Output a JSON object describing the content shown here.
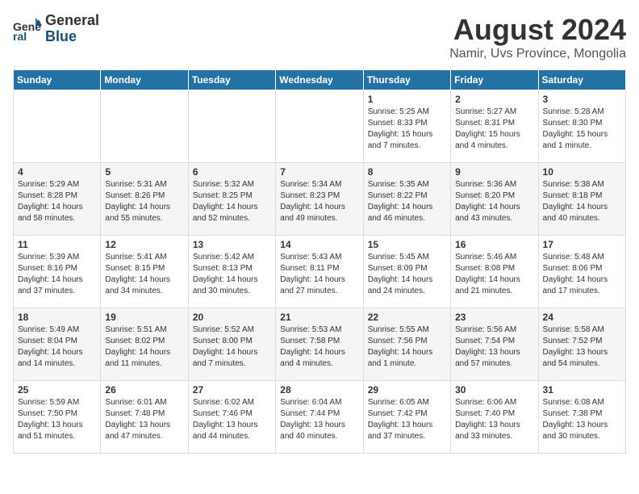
{
  "logo": {
    "general": "General",
    "blue": "Blue"
  },
  "header": {
    "month": "August 2024",
    "location": "Namir, Uvs Province, Mongolia"
  },
  "weekdays": [
    "Sunday",
    "Monday",
    "Tuesday",
    "Wednesday",
    "Thursday",
    "Friday",
    "Saturday"
  ],
  "weeks": [
    [
      {
        "day": "",
        "info": ""
      },
      {
        "day": "",
        "info": ""
      },
      {
        "day": "",
        "info": ""
      },
      {
        "day": "",
        "info": ""
      },
      {
        "day": "1",
        "info": "Sunrise: 5:25 AM\nSunset: 8:33 PM\nDaylight: 15 hours\nand 7 minutes."
      },
      {
        "day": "2",
        "info": "Sunrise: 5:27 AM\nSunset: 8:31 PM\nDaylight: 15 hours\nand 4 minutes."
      },
      {
        "day": "3",
        "info": "Sunrise: 5:28 AM\nSunset: 8:30 PM\nDaylight: 15 hours\nand 1 minute."
      }
    ],
    [
      {
        "day": "4",
        "info": "Sunrise: 5:29 AM\nSunset: 8:28 PM\nDaylight: 14 hours\nand 58 minutes."
      },
      {
        "day": "5",
        "info": "Sunrise: 5:31 AM\nSunset: 8:26 PM\nDaylight: 14 hours\nand 55 minutes."
      },
      {
        "day": "6",
        "info": "Sunrise: 5:32 AM\nSunset: 8:25 PM\nDaylight: 14 hours\nand 52 minutes."
      },
      {
        "day": "7",
        "info": "Sunrise: 5:34 AM\nSunset: 8:23 PM\nDaylight: 14 hours\nand 49 minutes."
      },
      {
        "day": "8",
        "info": "Sunrise: 5:35 AM\nSunset: 8:22 PM\nDaylight: 14 hours\nand 46 minutes."
      },
      {
        "day": "9",
        "info": "Sunrise: 5:36 AM\nSunset: 8:20 PM\nDaylight: 14 hours\nand 43 minutes."
      },
      {
        "day": "10",
        "info": "Sunrise: 5:38 AM\nSunset: 8:18 PM\nDaylight: 14 hours\nand 40 minutes."
      }
    ],
    [
      {
        "day": "11",
        "info": "Sunrise: 5:39 AM\nSunset: 8:16 PM\nDaylight: 14 hours\nand 37 minutes."
      },
      {
        "day": "12",
        "info": "Sunrise: 5:41 AM\nSunset: 8:15 PM\nDaylight: 14 hours\nand 34 minutes."
      },
      {
        "day": "13",
        "info": "Sunrise: 5:42 AM\nSunset: 8:13 PM\nDaylight: 14 hours\nand 30 minutes."
      },
      {
        "day": "14",
        "info": "Sunrise: 5:43 AM\nSunset: 8:11 PM\nDaylight: 14 hours\nand 27 minutes."
      },
      {
        "day": "15",
        "info": "Sunrise: 5:45 AM\nSunset: 8:09 PM\nDaylight: 14 hours\nand 24 minutes."
      },
      {
        "day": "16",
        "info": "Sunrise: 5:46 AM\nSunset: 8:08 PM\nDaylight: 14 hours\nand 21 minutes."
      },
      {
        "day": "17",
        "info": "Sunrise: 5:48 AM\nSunset: 8:06 PM\nDaylight: 14 hours\nand 17 minutes."
      }
    ],
    [
      {
        "day": "18",
        "info": "Sunrise: 5:49 AM\nSunset: 8:04 PM\nDaylight: 14 hours\nand 14 minutes."
      },
      {
        "day": "19",
        "info": "Sunrise: 5:51 AM\nSunset: 8:02 PM\nDaylight: 14 hours\nand 11 minutes."
      },
      {
        "day": "20",
        "info": "Sunrise: 5:52 AM\nSunset: 8:00 PM\nDaylight: 14 hours\nand 7 minutes."
      },
      {
        "day": "21",
        "info": "Sunrise: 5:53 AM\nSunset: 7:58 PM\nDaylight: 14 hours\nand 4 minutes."
      },
      {
        "day": "22",
        "info": "Sunrise: 5:55 AM\nSunset: 7:56 PM\nDaylight: 14 hours\nand 1 minute."
      },
      {
        "day": "23",
        "info": "Sunrise: 5:56 AM\nSunset: 7:54 PM\nDaylight: 13 hours\nand 57 minutes."
      },
      {
        "day": "24",
        "info": "Sunrise: 5:58 AM\nSunset: 7:52 PM\nDaylight: 13 hours\nand 54 minutes."
      }
    ],
    [
      {
        "day": "25",
        "info": "Sunrise: 5:59 AM\nSunset: 7:50 PM\nDaylight: 13 hours\nand 51 minutes."
      },
      {
        "day": "26",
        "info": "Sunrise: 6:01 AM\nSunset: 7:48 PM\nDaylight: 13 hours\nand 47 minutes."
      },
      {
        "day": "27",
        "info": "Sunrise: 6:02 AM\nSunset: 7:46 PM\nDaylight: 13 hours\nand 44 minutes."
      },
      {
        "day": "28",
        "info": "Sunrise: 6:04 AM\nSunset: 7:44 PM\nDaylight: 13 hours\nand 40 minutes."
      },
      {
        "day": "29",
        "info": "Sunrise: 6:05 AM\nSunset: 7:42 PM\nDaylight: 13 hours\nand 37 minutes."
      },
      {
        "day": "30",
        "info": "Sunrise: 6:06 AM\nSunset: 7:40 PM\nDaylight: 13 hours\nand 33 minutes."
      },
      {
        "day": "31",
        "info": "Sunrise: 6:08 AM\nSunset: 7:38 PM\nDaylight: 13 hours\nand 30 minutes."
      }
    ]
  ]
}
